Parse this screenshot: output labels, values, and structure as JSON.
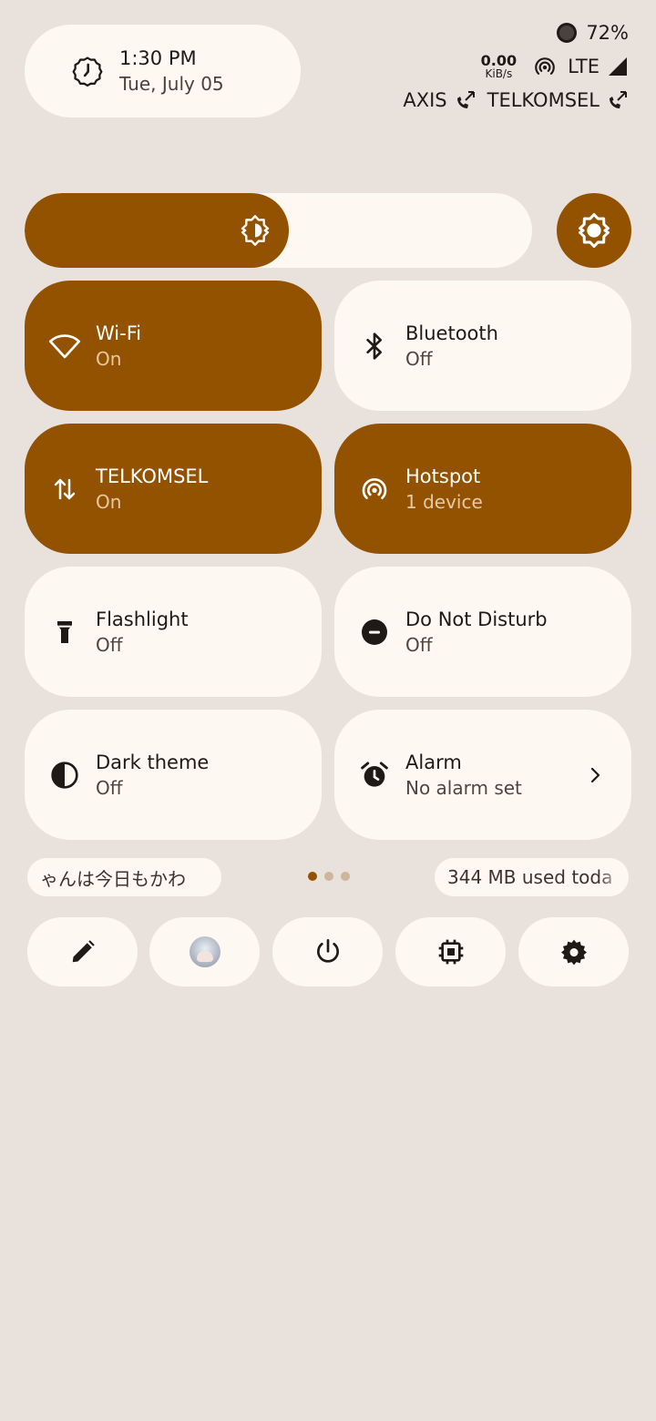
{
  "header": {
    "time": "1:30 PM",
    "date": "Tue, July 05",
    "clock_icon": "clock-icon"
  },
  "status": {
    "battery_percent": "72%",
    "net_speed_value": "0.00",
    "net_speed_unit": "KiB/s",
    "network_type": "LTE",
    "carriers": [
      "AXIS",
      "TELKOMSEL"
    ]
  },
  "brightness": {
    "level": 0.52,
    "auto_icon": "auto-brightness-icon"
  },
  "tiles": [
    {
      "label": "Wi-Fi",
      "sub": "On",
      "icon": "wifi-icon",
      "active": true
    },
    {
      "label": "Bluetooth",
      "sub": "Off",
      "icon": "bluetooth-icon",
      "active": false
    },
    {
      "label": "TELKOMSEL",
      "sub": "On",
      "icon": "mobile-data-icon",
      "active": true
    },
    {
      "label": "Hotspot",
      "sub": "1 device",
      "icon": "hotspot-icon",
      "active": true
    },
    {
      "label": "Flashlight",
      "sub": "Off",
      "icon": "flashlight-icon",
      "active": false
    },
    {
      "label": "Do Not Disturb",
      "sub": "Off",
      "icon": "do-not-disturb-icon",
      "active": false
    },
    {
      "label": "Dark theme",
      "sub": "Off",
      "icon": "dark-theme-icon",
      "active": false
    },
    {
      "label": "Alarm",
      "sub": "No alarm set",
      "icon": "alarm-icon",
      "active": false
    }
  ],
  "footer": {
    "media_text": "ゃんは今日もかわ",
    "data_usage": "344 MB used toda",
    "page_count": 3,
    "active_page": 0
  },
  "colors": {
    "accent": "#935200",
    "surface": "#fdf8f2",
    "background": "#e9e1dc"
  }
}
